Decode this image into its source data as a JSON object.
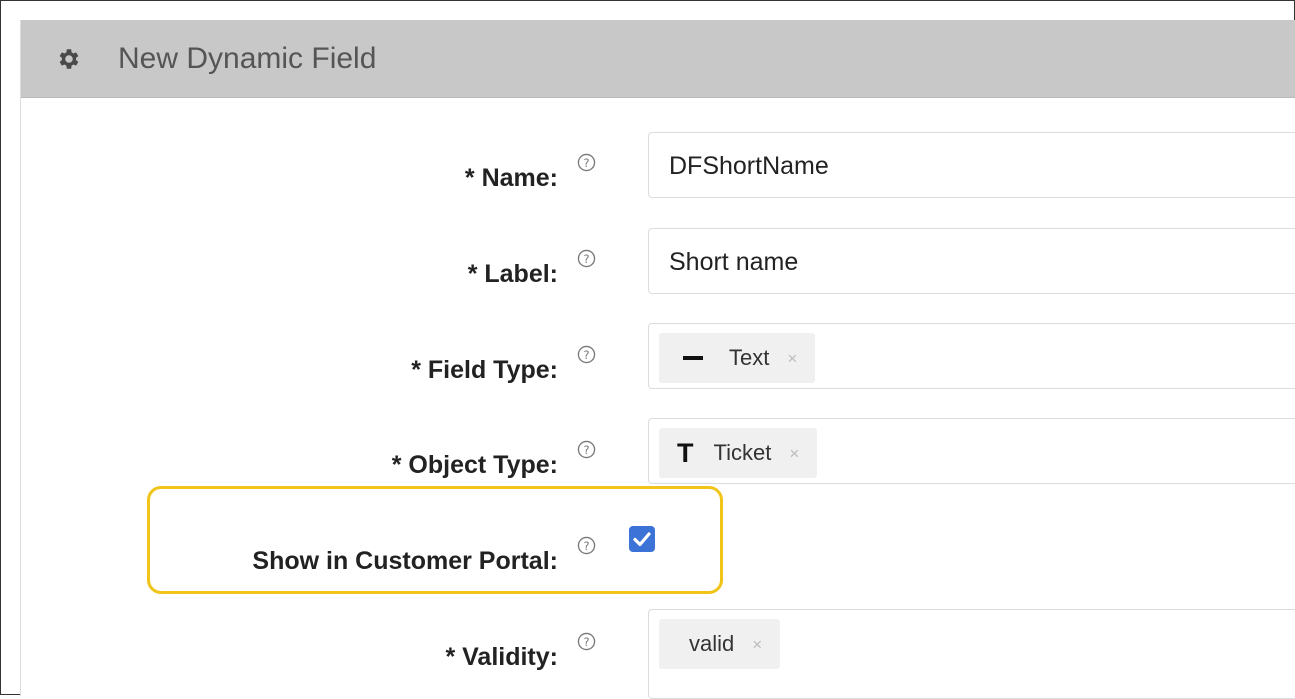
{
  "header": {
    "icon": "gear-icon",
    "title": "New Dynamic Field"
  },
  "form": {
    "name": {
      "label": "* Name:",
      "value": "DFShortName"
    },
    "label": {
      "label": "* Label:",
      "value": "Short name"
    },
    "field_type": {
      "label": "* Field Type:",
      "value": "Text",
      "icon": "dash-icon"
    },
    "object_type": {
      "label": "* Object Type:",
      "value": "Ticket",
      "icon": "t-icon"
    },
    "show_in_portal": {
      "label": "Show in Customer Portal:",
      "checked": true
    },
    "validity": {
      "label": "* Validity:",
      "value": "valid"
    },
    "help_icon": "question-circle-icon",
    "remove_symbol": "×"
  },
  "colors": {
    "header_bg": "#c8c8c8",
    "highlight": "#f0c419",
    "checkbox": "#3b73d6"
  }
}
